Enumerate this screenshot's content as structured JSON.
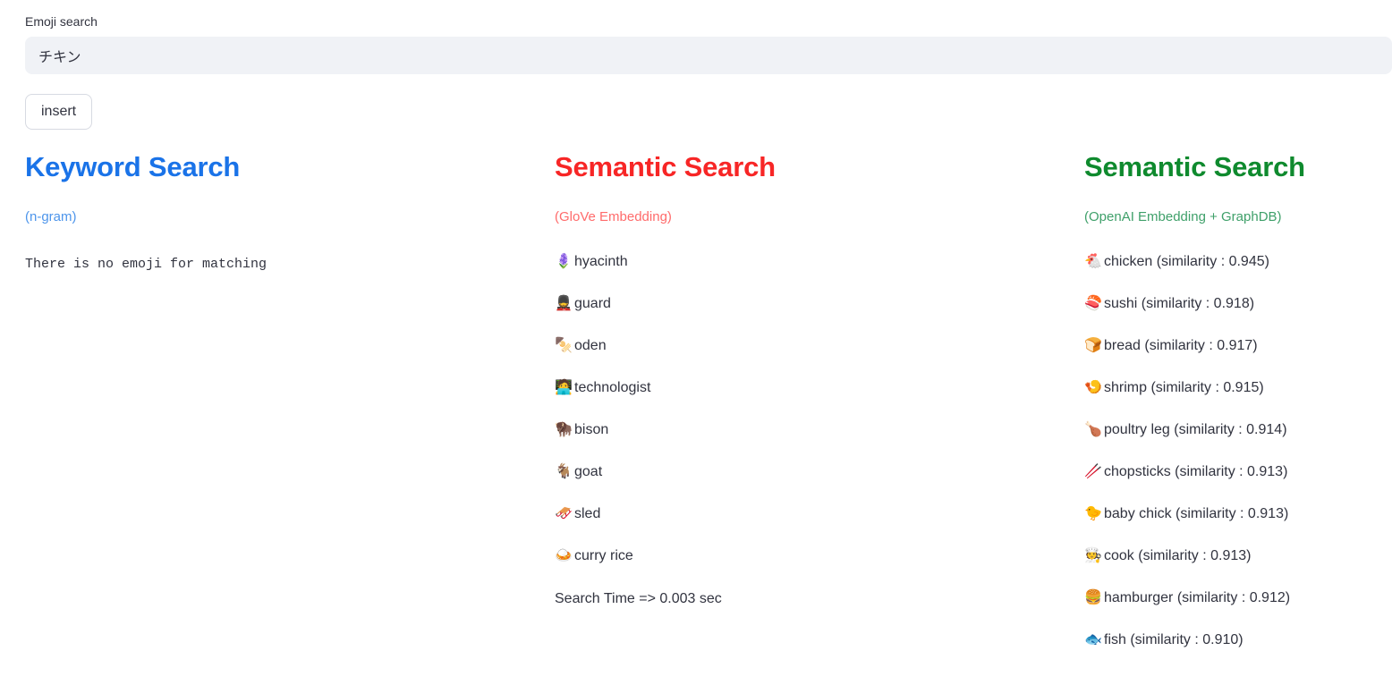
{
  "search": {
    "label": "Emoji search",
    "value": "チキン",
    "placeholder": "",
    "insert_label": "insert"
  },
  "colors": {
    "keyword_title": "#1a73e8",
    "keyword_subtitle": "#4d95eb",
    "glove_title": "#f72626",
    "glove_subtitle": "#ff6b6b",
    "openai_title": "#0f8a2e",
    "openai_subtitle": "#3fa06a",
    "text": "#31333f",
    "input_bg": "#f0f2f6"
  },
  "columns": [
    {
      "id": "keyword",
      "title": "Keyword Search",
      "subtitle": "(n-gram)",
      "message": "There is no emoji for matching",
      "results": []
    },
    {
      "id": "glove",
      "title": "Semantic Search",
      "subtitle": "(GloVe Embedding)",
      "results": [
        {
          "emoji": "🪻",
          "label": "hyacinth"
        },
        {
          "emoji": "💂",
          "label": "guard"
        },
        {
          "emoji": "🍢",
          "label": "oden"
        },
        {
          "emoji": "🧑‍💻",
          "label": "technologist"
        },
        {
          "emoji": "🦬",
          "label": "bison"
        },
        {
          "emoji": "🐐",
          "label": "goat"
        },
        {
          "emoji": "🛷",
          "label": "sled"
        },
        {
          "emoji": "🍛",
          "label": "curry rice"
        }
      ],
      "search_time": "Search Time => 0.003 sec"
    },
    {
      "id": "openai",
      "title": "Semantic Search",
      "subtitle": "(OpenAI Embedding + GraphDB)",
      "results": [
        {
          "emoji": "🐔",
          "label": "chicken (similarity : 0.945)"
        },
        {
          "emoji": "🍣",
          "label": "sushi (similarity : 0.918)"
        },
        {
          "emoji": "🍞",
          "label": "bread (similarity : 0.917)"
        },
        {
          "emoji": "🍤",
          "label": "shrimp (similarity : 0.915)"
        },
        {
          "emoji": "🍗",
          "label": "poultry leg (similarity : 0.914)"
        },
        {
          "emoji": "🥢",
          "label": "chopsticks (similarity : 0.913)"
        },
        {
          "emoji": "🐤",
          "label": "baby chick (similarity : 0.913)"
        },
        {
          "emoji": "🧑‍🍳",
          "label": "cook (similarity : 0.913)"
        },
        {
          "emoji": "🍔",
          "label": "hamburger (similarity : 0.912)"
        },
        {
          "emoji": "🐟",
          "label": "fish (similarity : 0.910)"
        }
      ]
    }
  ]
}
